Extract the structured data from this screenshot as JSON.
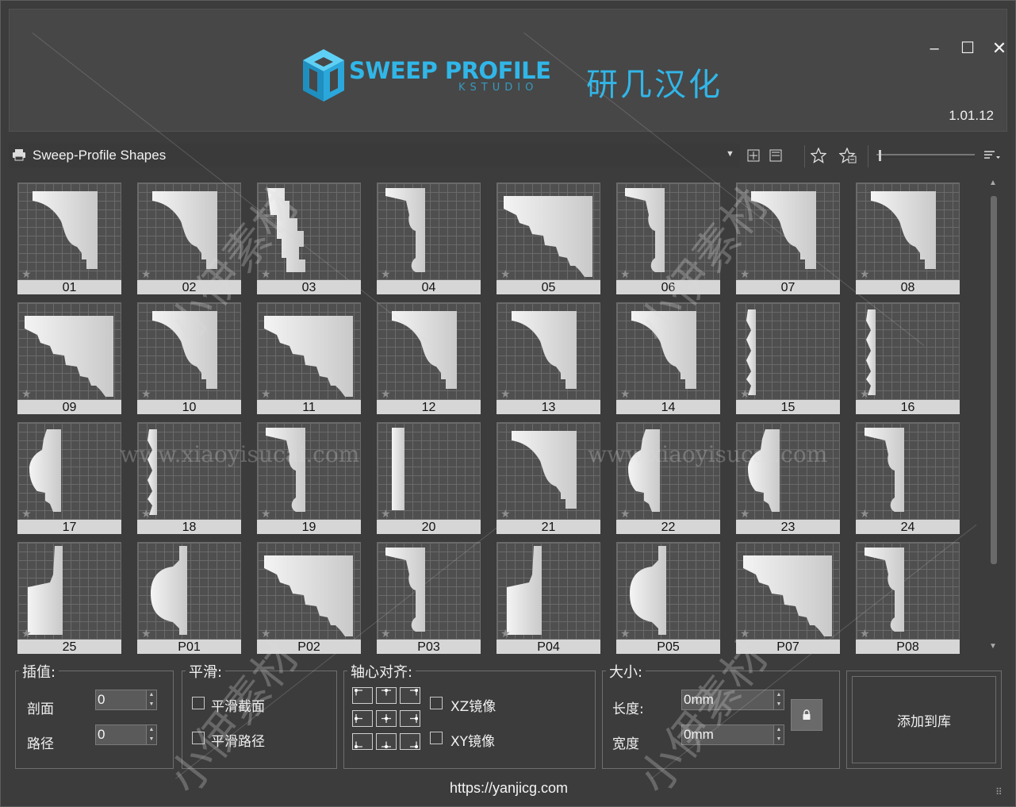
{
  "app": {
    "logo_text": "SWEEP PROFILE",
    "logo_subtext": "KSTUDIO",
    "logo_chinese": "研几汉化",
    "version": "1.01.12",
    "window_controls": {
      "minimize": "–",
      "maximize": "☐",
      "close": "✕"
    }
  },
  "toolbar": {
    "library_name": "Sweep-Profile Shapes",
    "icons": [
      "printer-icon",
      "dropdown-arrow-icon",
      "expand-grid-icon",
      "collapse-grid-icon",
      "star-icon",
      "star-manage-icon",
      "size-slider",
      "sort-menu-icon"
    ]
  },
  "shapes": [
    {
      "label": "01",
      "kind": "cove"
    },
    {
      "label": "02",
      "kind": "cove"
    },
    {
      "label": "03",
      "kind": "steps"
    },
    {
      "label": "04",
      "kind": "slim"
    },
    {
      "label": "05",
      "kind": "wide"
    },
    {
      "label": "06",
      "kind": "slim"
    },
    {
      "label": "07",
      "kind": "cove"
    },
    {
      "label": "08",
      "kind": "cove"
    },
    {
      "label": "09",
      "kind": "wide"
    },
    {
      "label": "10",
      "kind": "cove"
    },
    {
      "label": "11",
      "kind": "wide"
    },
    {
      "label": "12",
      "kind": "cove"
    },
    {
      "label": "13",
      "kind": "cove"
    },
    {
      "label": "14",
      "kind": "cove"
    },
    {
      "label": "15",
      "kind": "trim"
    },
    {
      "label": "16",
      "kind": "trim"
    },
    {
      "label": "17",
      "kind": "bump"
    },
    {
      "label": "18",
      "kind": "trim"
    },
    {
      "label": "19",
      "kind": "slim"
    },
    {
      "label": "20",
      "kind": "bar"
    },
    {
      "label": "21",
      "kind": "cove"
    },
    {
      "label": "22",
      "kind": "bump"
    },
    {
      "label": "23",
      "kind": "bump"
    },
    {
      "label": "24",
      "kind": "slim"
    },
    {
      "label": "25",
      "kind": "block"
    },
    {
      "label": "P01",
      "kind": "round"
    },
    {
      "label": "P02",
      "kind": "wide"
    },
    {
      "label": "P03",
      "kind": "slim"
    },
    {
      "label": "P04",
      "kind": "block"
    },
    {
      "label": "P05",
      "kind": "round"
    },
    {
      "label": "P07",
      "kind": "wide"
    },
    {
      "label": "P08",
      "kind": "slim"
    }
  ],
  "interpolation": {
    "title": "插值:",
    "section_label": "剖面",
    "section_value": "0",
    "path_label": "路径",
    "path_value": "0"
  },
  "smoothing": {
    "title": "平滑:",
    "smooth_section": "平滑截面",
    "smooth_path": "平滑路径"
  },
  "pivot": {
    "title": "轴心对齐:",
    "xz_mirror": "XZ镜像",
    "xy_mirror": "XY镜像"
  },
  "size": {
    "title": "大小:",
    "length_label": "长度:",
    "length_value": "0mm",
    "width_label": "宽度",
    "width_value": "0mm"
  },
  "add_to_library": "添加到库",
  "footer_url": "https://yanjicg.com",
  "watermarks": {
    "cn": "小伊素材",
    "url": "www.xiaoyisucai.com"
  },
  "colors": {
    "accent": "#31b6e8",
    "window_bg": "#3c3c3c",
    "caption_bg": "#d6d6d6"
  }
}
